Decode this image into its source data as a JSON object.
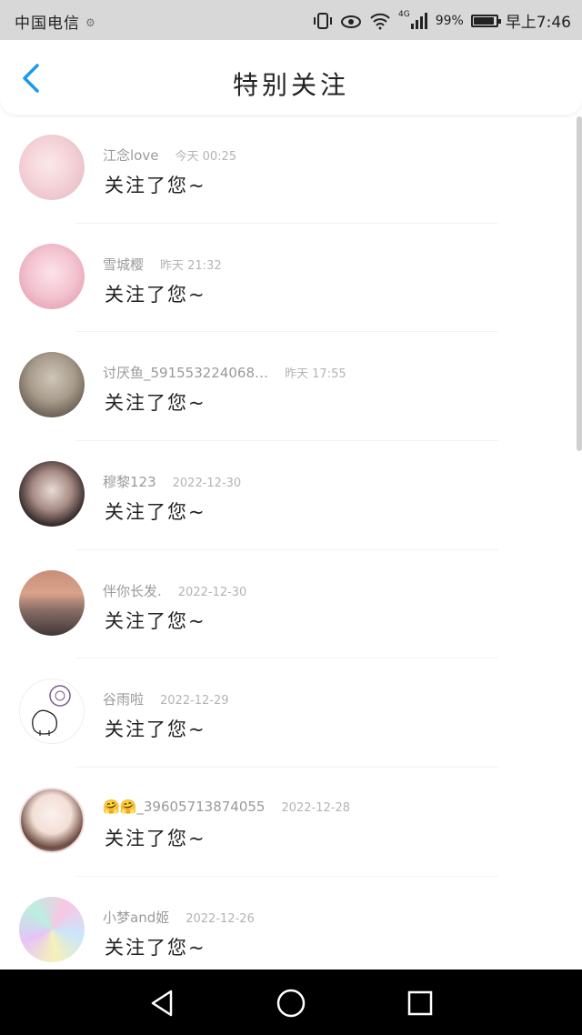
{
  "status_bar": {
    "carrier": "中国电信",
    "network": "4G",
    "battery": "99%",
    "time": "早上7:46",
    "battery_level": 0.99
  },
  "header": {
    "title": "特别关注",
    "back_icon": "chevron-left-icon"
  },
  "colors": {
    "accent": "#1a9af0",
    "text_primary": "#222222",
    "text_secondary": "#9a9a9a"
  },
  "items": [
    {
      "name": "江念love",
      "time": "今天 00:25",
      "message": "关注了您~"
    },
    {
      "name": "雪城樱",
      "time": "昨天 21:32",
      "message": "关注了您~"
    },
    {
      "name": "讨厌鱼_591553224068…",
      "time": "昨天 17:55",
      "message": "关注了您~"
    },
    {
      "name": "穆黎123",
      "time": "2022-12-30",
      "message": "关注了您~"
    },
    {
      "name": "伴你长发.",
      "time": "2022-12-30",
      "message": "关注了您~"
    },
    {
      "name": "谷雨啦",
      "time": "2022-12-29",
      "message": "关注了您~"
    },
    {
      "name": "🤗🤗_39605713874055",
      "time": "2022-12-28",
      "message": "关注了您~"
    },
    {
      "name": "小梦and姬",
      "time": "2022-12-26",
      "message": "关注了您~"
    }
  ],
  "navbar": {
    "back_icon": "triangle-back-icon",
    "home_icon": "circle-home-icon",
    "recents_icon": "square-recents-icon"
  }
}
